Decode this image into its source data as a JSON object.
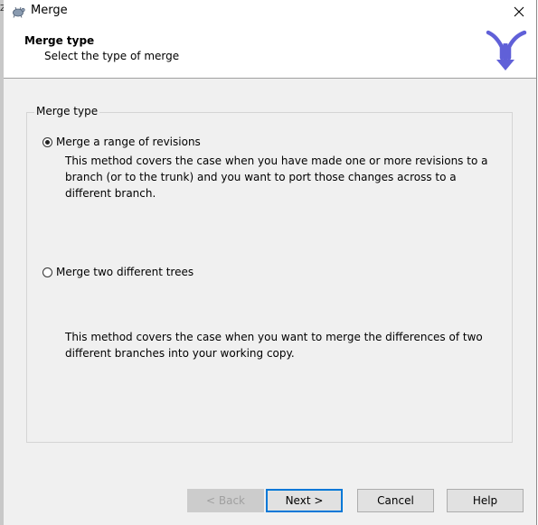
{
  "window": {
    "title": "Merge",
    "edge_clip_text": "Z"
  },
  "header": {
    "title": "Merge type",
    "subtitle": "Select the type of merge"
  },
  "group": {
    "label": "Merge type",
    "options": [
      {
        "label": "Merge a range of revisions",
        "checked": true,
        "description": "This method covers the case when you have made one or more revisions to a branch (or to the trunk) and you want to port those changes across to a different branch."
      },
      {
        "label": "Merge two different trees",
        "checked": false,
        "description": "This method covers the case when you want to merge the differences of two different branches into your working copy."
      }
    ]
  },
  "buttons": {
    "back": "< Back",
    "next": "Next >",
    "cancel": "Cancel",
    "help": "Help"
  },
  "colors": {
    "logo": "#5b5bd6",
    "default_button_border": "#0078d7",
    "dialog_bg": "#f0f0f0"
  }
}
